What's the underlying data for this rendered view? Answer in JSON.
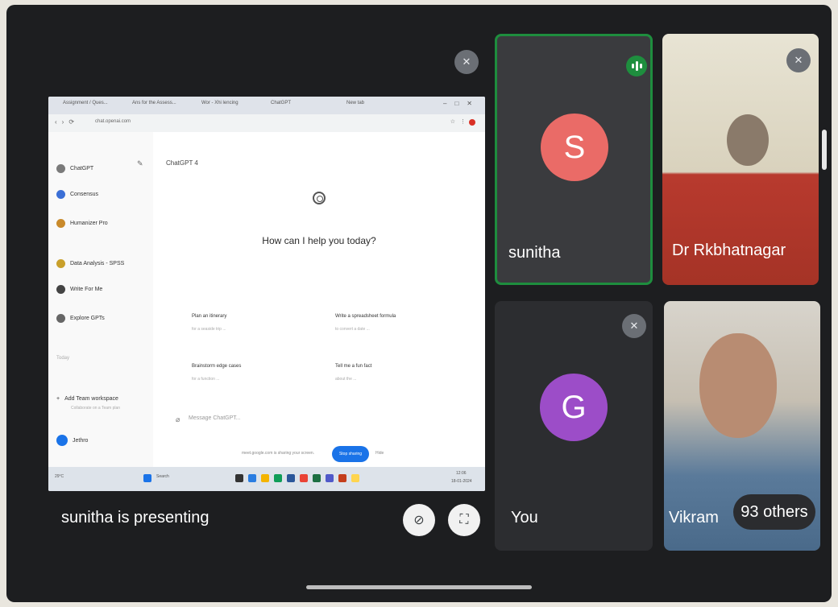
{
  "presentation": {
    "presenter_label": "sunitha is presenting",
    "shared_screen": {
      "tabs": [
        "Assignment / Ques...",
        "Ans for the Assess...",
        "Wor - Xhi lencing",
        "ChatGPT",
        "New tab"
      ],
      "url": "chat.openai.com",
      "chatgpt": {
        "sidebar_items": [
          {
            "label": "ChatGPT",
            "color": "#7a7a7a"
          },
          {
            "label": "Consensus",
            "color": "#3b6fd6"
          },
          {
            "label": "Humanizer Pro",
            "color": "#c98a2b"
          },
          {
            "label": "Data Analysis - SPSS",
            "color": "#c9a02b"
          },
          {
            "label": "Write For Me",
            "color": "#444444"
          },
          {
            "label": "Explore GPTs",
            "color": "#666666"
          }
        ],
        "section_label": "Today",
        "workspace": {
          "title": "Add Team workspace",
          "subtitle": "Collaborate on a Team plan"
        },
        "user_label": "Jethro",
        "model_label": "ChatGPT 4",
        "headline": "How can I help you today?",
        "suggestions": [
          {
            "title": "Plan an itinerary",
            "subtitle": "for a seaside trip ..."
          },
          {
            "title": "Write a spreadsheet formula",
            "subtitle": "to convert a date ..."
          },
          {
            "title": "Brainstorm edge cases",
            "subtitle": "for a function ..."
          },
          {
            "title": "Tell me a fun fact",
            "subtitle": "about the ..."
          }
        ],
        "message_placeholder": "Message ChatGPT...",
        "share_notice": "meet.google.com is sharing your screen.",
        "stop_sharing_label": "Stop sharing",
        "hide_label": "Hide"
      },
      "taskbar": {
        "weather": "29°C",
        "search": "Search",
        "time": "12:06",
        "date": "18-01-2024"
      }
    }
  },
  "participants": [
    {
      "name": "sunitha",
      "initial": "S",
      "avatar_color": "#ea6b67",
      "speaking": true
    },
    {
      "name": "Dr Rkbhatnagar",
      "muted": true
    },
    {
      "name": "You",
      "initial": "G",
      "avatar_color": "#9c4dc8",
      "muted": true
    },
    {
      "name": "Vikram",
      "muted": false
    }
  ],
  "others_count_label": "93 others"
}
